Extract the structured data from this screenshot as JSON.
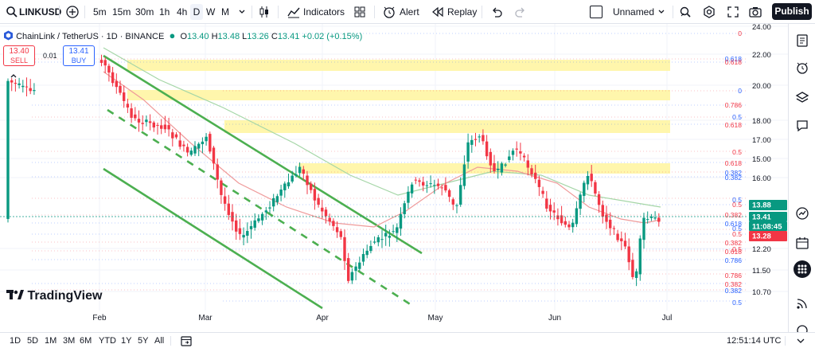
{
  "toolbar": {
    "symbol": "LINKUSD",
    "intervals": [
      "5m",
      "15m",
      "30m",
      "1h",
      "4h",
      "D",
      "W",
      "M"
    ],
    "selected_interval": "D",
    "indicators_label": "Indicators",
    "alert_label": "Alert",
    "replay_label": "Replay",
    "layout_name": "Unnamed",
    "publish_label": "Publish"
  },
  "legend": {
    "title": "ChainLink / TetherUS · 1D · BINANCE",
    "o_label": "O",
    "o": "13.40",
    "h_label": "H",
    "h": "13.48",
    "l_label": "L",
    "l": "13.26",
    "c_label": "C",
    "c": "13.41",
    "change": "+0.02 (+0.15%)"
  },
  "trade": {
    "sell_price": "13.40",
    "sell_label": "SELL",
    "spread": "0.01",
    "buy_price": "13.41",
    "buy_label": "BUY"
  },
  "chart_data": {
    "type": "candlestick",
    "x_labels": [
      "Feb",
      "Mar",
      "Apr",
      "May",
      "Jun",
      "Jul"
    ],
    "y_ticks": [
      "24.00",
      "22.00",
      "20.00",
      "18.00",
      "17.00",
      "15.00",
      "16.00",
      "12.20",
      "11.50",
      "10.70"
    ],
    "price_labels": [
      {
        "value": "13.88",
        "color": "#089981"
      },
      {
        "value": "13.41",
        "color": "#089981"
      },
      {
        "value": "11:08:45",
        "color": "#089981"
      },
      {
        "value": "13.28",
        "color": "#f23645"
      }
    ],
    "fib_labels": [
      {
        "text": "0",
        "color": "#f23645"
      },
      {
        "text": "0.618",
        "color": "#2962ff"
      },
      {
        "text": "0.618",
        "color": "#f23645"
      },
      {
        "text": "0",
        "color": "#2962ff"
      },
      {
        "text": "0.786",
        "color": "#f23645"
      },
      {
        "text": "0.5",
        "color": "#2962ff"
      },
      {
        "text": "0.618",
        "color": "#f23645"
      },
      {
        "text": "0.5",
        "color": "#f23645"
      },
      {
        "text": "0.618",
        "color": "#f23645"
      },
      {
        "text": "0.382",
        "color": "#2962ff"
      },
      {
        "text": "0.382",
        "color": "#2962ff"
      },
      {
        "text": "0.5",
        "color": "#2962ff"
      },
      {
        "text": "0.5",
        "color": "#f23645"
      },
      {
        "text": "0.382",
        "color": "#f23645"
      },
      {
        "text": "0.618",
        "color": "#2962ff"
      },
      {
        "text": "0.5",
        "color": "#2962ff"
      },
      {
        "text": "0.5",
        "color": "#f23645"
      },
      {
        "text": "0.382",
        "color": "#f23645"
      },
      {
        "text": "0.5",
        "color": "#f23645"
      },
      {
        "text": "0.618",
        "color": "#f23645"
      },
      {
        "text": "0.786",
        "color": "#2962ff"
      },
      {
        "text": "0.786",
        "color": "#f23645"
      },
      {
        "text": "0.382",
        "color": "#f23645"
      },
      {
        "text": "0.382",
        "color": "#2962ff"
      },
      {
        "text": "0.5",
        "color": "#2962ff"
      }
    ],
    "up_color": "#089981",
    "down_color": "#f23645",
    "zone_color": "#fff59d",
    "channel_color": "#4caf50"
  },
  "bottom": {
    "ranges": [
      "1D",
      "5D",
      "1M",
      "3M",
      "6M",
      "YTD",
      "1Y",
      "5Y",
      "All"
    ],
    "clock": "12:51:14 UTC"
  },
  "watermark": "TradingView"
}
